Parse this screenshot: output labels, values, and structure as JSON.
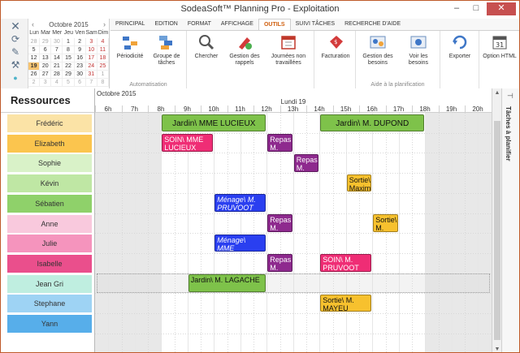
{
  "window": {
    "title": "SodeaSoft™ Planning Pro - Exploitation"
  },
  "calendar": {
    "month": "Octobre 2015",
    "dow": [
      "Lun",
      "Mar",
      "Mer",
      "Jeu",
      "Ven",
      "Sam",
      "Dim"
    ],
    "weeks": [
      [
        "28",
        "29",
        "30",
        "1",
        "2",
        "3",
        "4"
      ],
      [
        "5",
        "6",
        "7",
        "8",
        "9",
        "10",
        "11"
      ],
      [
        "12",
        "13",
        "14",
        "15",
        "16",
        "17",
        "18"
      ],
      [
        "19",
        "20",
        "21",
        "22",
        "23",
        "24",
        "25"
      ],
      [
        "26",
        "27",
        "28",
        "29",
        "30",
        "31",
        "1"
      ],
      [
        "2",
        "3",
        "4",
        "5",
        "6",
        "7",
        "8"
      ]
    ],
    "today": "19"
  },
  "ribbon": {
    "tabs": [
      "PRINCIPAL",
      "EDITION",
      "FORMAT",
      "AFFICHAGE",
      "OUTILS",
      "SUIVI TÂCHES",
      "RECHERCHE D'AIDE"
    ],
    "active_tab": "OUTILS",
    "groups": {
      "automatisation": "Automatisation",
      "aide": "Aide à la planification"
    },
    "buttons": {
      "periodicite": "Périodicité",
      "groupe": "Groupe de tâches",
      "chercher": "Chercher",
      "rappels": "Gestion des rappels",
      "journees": "Journées non travaillées",
      "facturation": "Facturation",
      "besoins": "Gestion des besoins",
      "voir": "Voir les besoins",
      "exporter": "Exporter",
      "option": "Option HTML"
    }
  },
  "resources": {
    "title": "Ressources",
    "items": [
      {
        "name": "Frédéric",
        "color": "#fbe3a6"
      },
      {
        "name": "Elizabeth",
        "color": "#fbc54e"
      },
      {
        "name": "Sophie",
        "color": "#d9f2c8"
      },
      {
        "name": "Kévin",
        "color": "#bfe7a4"
      },
      {
        "name": "Sébatien",
        "color": "#8fd16a"
      },
      {
        "name": "Anne",
        "color": "#f9c9dd"
      },
      {
        "name": "Julie",
        "color": "#f594bd"
      },
      {
        "name": "Isabelle",
        "color": "#ea4f8c"
      },
      {
        "name": "Jean Gri",
        "color": "#bfeee0"
      },
      {
        "name": "Stephane",
        "color": "#9ed3f4"
      },
      {
        "name": "Yann",
        "color": "#57aeea"
      }
    ]
  },
  "timeline": {
    "month": "Octobre 2015",
    "day": "Lundi 19",
    "hours": [
      "6h",
      "7h",
      "8h",
      "9h",
      "10h",
      "11h",
      "12h",
      "13h",
      "14h",
      "15h",
      "16h",
      "17h",
      "18h",
      "19h",
      "20h"
    ]
  },
  "events": [
    {
      "row": 0,
      "start": 8.0,
      "end": 12.0,
      "text": "Jardin\\ MME LUCIEUX",
      "color": "#7ec24a",
      "fg": "#111",
      "italic": false,
      "kind": "green"
    },
    {
      "row": 0,
      "start": 14.0,
      "end": 18.0,
      "text": "Jardin\\ M. DUPOND",
      "color": "#7ec24a",
      "fg": "#111",
      "italic": false,
      "kind": "green"
    },
    {
      "row": 1,
      "start": 8.0,
      "end": 10.0,
      "text": "SOIN\\ MME LUCIEUX",
      "color": "#ef2d75",
      "fg": "#fff",
      "italic": false,
      "kind": ""
    },
    {
      "row": 1,
      "start": 12.0,
      "end": 13.0,
      "text": "Repas M.",
      "color": "#8e2a8e",
      "fg": "#fff",
      "italic": false,
      "kind": ""
    },
    {
      "row": 2,
      "start": 13.0,
      "end": 14.0,
      "text": "Repas M.",
      "color": "#8e2a8e",
      "fg": "#fff",
      "italic": false,
      "kind": ""
    },
    {
      "row": 3,
      "start": 15.0,
      "end": 16.0,
      "text": "Sortie\\ Maxime",
      "color": "#f7c12e",
      "fg": "#111",
      "italic": false,
      "kind": ""
    },
    {
      "row": 4,
      "start": 10.0,
      "end": 12.0,
      "text": "Ménage\\ M. PRUVOOT",
      "color": "#2a3ff0",
      "fg": "#fff",
      "italic": true,
      "kind": ""
    },
    {
      "row": 5,
      "start": 12.0,
      "end": 13.0,
      "text": "Repas M.",
      "color": "#8e2a8e",
      "fg": "#fff",
      "italic": false,
      "kind": ""
    },
    {
      "row": 5,
      "start": 16.0,
      "end": 17.0,
      "text": "Sortie\\ M.",
      "color": "#f7c12e",
      "fg": "#111",
      "italic": false,
      "kind": ""
    },
    {
      "row": 6,
      "start": 10.0,
      "end": 12.0,
      "text": "Ménage\\ MME",
      "color": "#2a3ff0",
      "fg": "#fff",
      "italic": true,
      "kind": ""
    },
    {
      "row": 7,
      "start": 12.0,
      "end": 13.0,
      "text": "Repas M.",
      "color": "#8e2a8e",
      "fg": "#fff",
      "italic": false,
      "kind": ""
    },
    {
      "row": 7,
      "start": 14.0,
      "end": 16.0,
      "text": "SOIN\\ M. PRUVOOT",
      "color": "#ef2d75",
      "fg": "#fff",
      "italic": false,
      "kind": ""
    },
    {
      "row": 8,
      "start": 9.0,
      "end": 12.0,
      "text": "Jardin\\ M. LAGACHE",
      "color": "#7ec24a",
      "fg": "#111",
      "italic": false,
      "kind": ""
    },
    {
      "row": 9,
      "start": 14.0,
      "end": 16.0,
      "text": "Sortie\\ M. MAYEU",
      "color": "#f7c12e",
      "fg": "#111",
      "italic": false,
      "kind": ""
    }
  ],
  "selected_row": 8,
  "side_panel": {
    "label": "Tâches à planifier"
  },
  "icons": {
    "left": [
      "close-icon",
      "refresh-icon",
      "tools-icon",
      "wrench-icon",
      "dot-icon"
    ]
  }
}
